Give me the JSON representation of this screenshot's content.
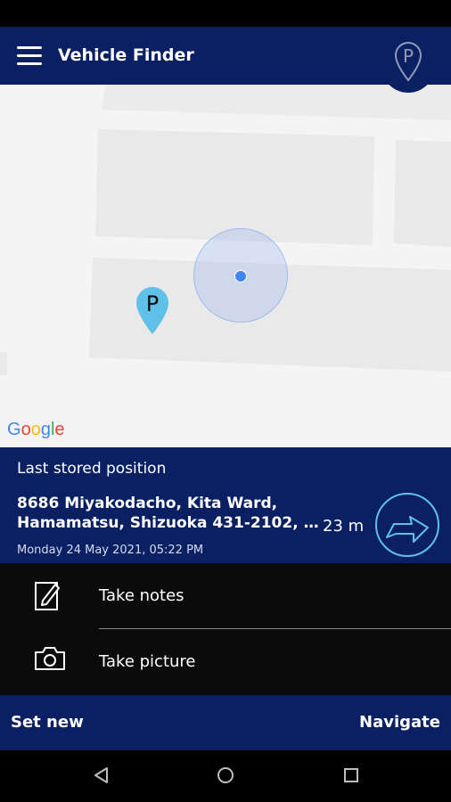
{
  "app_bar": {
    "title": "Vehicle Finder",
    "accent_color": "#0a2063"
  },
  "map": {
    "pin_letter": "P",
    "pin_color": "#5fc0e8",
    "google_logo": [
      "G",
      "o",
      "o",
      "g",
      "l",
      "e"
    ],
    "google_colors": [
      "#4285f4",
      "#ea4335",
      "#fbbc05",
      "#4285f4",
      "#34a853",
      "#ea4335"
    ]
  },
  "info": {
    "heading": "Last stored position",
    "address_line1": "8686 Miyakodacho, Kita Ward,",
    "address_line2": "Hamamatsu, Shizuoka 431-2102, J…",
    "timestamp": "Monday 24 May 2021, 05:22 PM",
    "distance": "23 m"
  },
  "actions": [
    {
      "label": "Take notes",
      "icon": "edit-note-icon"
    },
    {
      "label": "Take picture",
      "icon": "camera-icon"
    }
  ],
  "bottom": {
    "set_new": "Set new",
    "navigate": "Navigate"
  },
  "nav_bar": {
    "icons": [
      "back-icon",
      "home-icon",
      "recents-icon"
    ]
  }
}
